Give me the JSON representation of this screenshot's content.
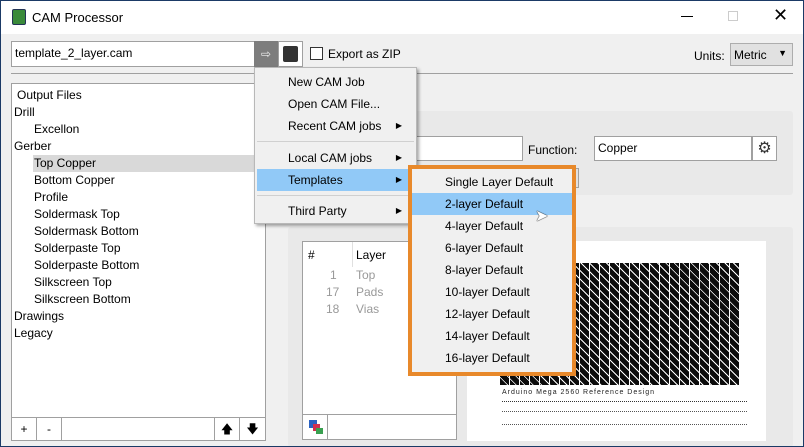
{
  "window": {
    "title": "CAM Processor",
    "app_icon": "brd-icon"
  },
  "toolbar": {
    "filename": "template_2_layer.cam",
    "export_zip_label": "Export as ZIP",
    "export_zip_checked": false,
    "units_label": "Units:",
    "units_value": "Metric"
  },
  "tree": {
    "header": "Output Files",
    "items": [
      {
        "label": "Drill",
        "level": 0
      },
      {
        "label": "Excellon",
        "level": 1
      },
      {
        "label": "Gerber",
        "level": 0
      },
      {
        "label": "Top Copper",
        "level": 1,
        "selected": true
      },
      {
        "label": "Bottom Copper",
        "level": 1
      },
      {
        "label": "Profile",
        "level": 1
      },
      {
        "label": "Soldermask Top",
        "level": 1
      },
      {
        "label": "Soldermask Bottom",
        "level": 1
      },
      {
        "label": "Solderpaste Top",
        "level": 1
      },
      {
        "label": "Solderpaste Bottom",
        "level": 1
      },
      {
        "label": "Silkscreen Top",
        "level": 1
      },
      {
        "label": "Silkscreen Bottom",
        "level": 1
      },
      {
        "label": "Drawings",
        "level": 0
      },
      {
        "label": "Legacy",
        "level": 0
      }
    ],
    "add_label": "+",
    "remove_label": "-"
  },
  "details": {
    "function_label": "Function:",
    "function_value": "Copper"
  },
  "layers": {
    "col_num": "#",
    "col_layer": "Layer",
    "rows": [
      {
        "num": "1",
        "name": "Top"
      },
      {
        "num": "17",
        "name": "Pads"
      },
      {
        "num": "18",
        "name": "Vias"
      }
    ]
  },
  "preview": {
    "caption1": "Arduino Mega 2560 Reference Design"
  },
  "menu": {
    "items": [
      {
        "label": "New CAM Job"
      },
      {
        "label": "Open CAM File..."
      },
      {
        "label": "Recent CAM jobs"
      },
      {
        "label": "Local CAM jobs"
      },
      {
        "label": "Templates"
      },
      {
        "label": "Third Party"
      }
    ]
  },
  "submenu": {
    "items": [
      "Single Layer Default",
      "2-layer Default",
      "4-layer Default",
      "6-layer Default",
      "8-layer Default",
      "10-layer Default",
      "12-layer Default",
      "14-layer Default",
      "16-layer Default"
    ],
    "highlighted": "2-layer Default"
  },
  "colors": {
    "highlight": "#91c9f7",
    "callout": "#e8892b"
  }
}
